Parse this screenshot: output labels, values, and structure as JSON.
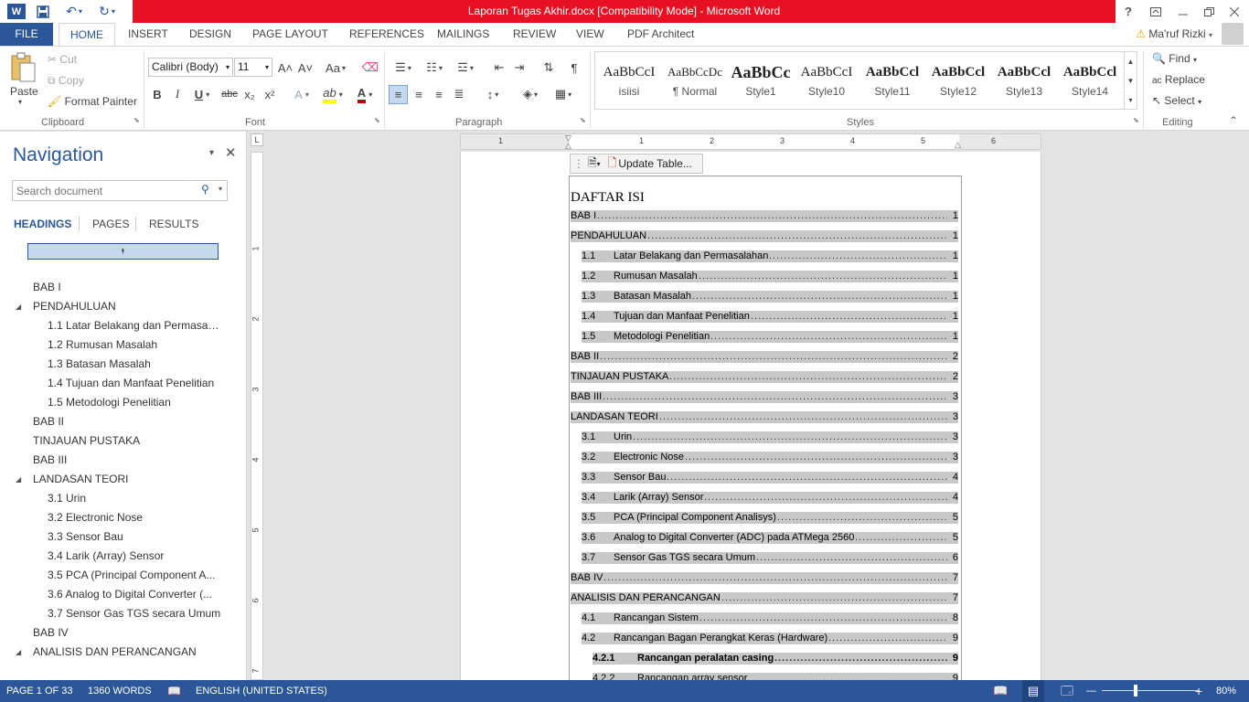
{
  "window": {
    "title": "Laporan Tugas Akhir.docx [Compatibility Mode] -  Microsoft Word",
    "help": "?",
    "buttons": {
      "restore_ribbon": "⬒",
      "minimize": "—",
      "maximize": "❐",
      "close": "✕"
    }
  },
  "quick_access": {
    "word_icon": "W",
    "save": "💾",
    "undo": "↶",
    "redo": "↻"
  },
  "ribbon_tabs": [
    "FILE",
    "HOME",
    "INSERT",
    "DESIGN",
    "PAGE LAYOUT",
    "REFERENCES",
    "MAILINGS",
    "REVIEW",
    "VIEW",
    "PDF Architect"
  ],
  "user": {
    "name": "Ma'ruf Rizki",
    "warning": "⚠"
  },
  "clipboard": {
    "paste": "Paste",
    "cut": "Cut",
    "copy": "Copy",
    "format_painter": "Format Painter",
    "label": "Clipboard"
  },
  "font": {
    "name": "Calibri (Body)",
    "size": "11",
    "grow": "A˄",
    "shrink": "A˅",
    "case": "Aa",
    "bold": "B",
    "italic": "I",
    "underline": "U",
    "strike": "abc",
    "subscript": "x₂",
    "superscript": "x²",
    "text_effects": "A",
    "highlight": "ab",
    "font_color": "A",
    "label": "Font"
  },
  "paragraph": {
    "label": "Paragraph",
    "pilcrow": "¶"
  },
  "styles": {
    "items": [
      {
        "preview": "AaBbCcI",
        "name": "isiisi"
      },
      {
        "preview": "AaBbCcDc",
        "name": "¶ Normal"
      },
      {
        "preview": "AaBbCс",
        "name": "Style1"
      },
      {
        "preview": "AaBbCcI",
        "name": "Style10"
      },
      {
        "preview": "AaBbCcl",
        "name": "Style11"
      },
      {
        "preview": "AaBbCcl",
        "name": "Style12"
      },
      {
        "preview": "AaBbCcl",
        "name": "Style13"
      },
      {
        "preview": "AaBbCcl",
        "name": "Style14"
      }
    ],
    "label": "Styles"
  },
  "editing": {
    "find": "Find",
    "replace": "Replace",
    "select": "Select",
    "label": "Editing"
  },
  "navigation": {
    "title": "Navigation",
    "search_placeholder": "Search document",
    "tabs": [
      "HEADINGS",
      "PAGES",
      "RESULTS"
    ],
    "items": [
      {
        "text": "BAB I",
        "level": 1,
        "expander": false
      },
      {
        "text": "PENDAHULUAN",
        "level": 1,
        "expander": true
      },
      {
        "text": "1.1 Latar Belakang dan Permasala...",
        "level": 2,
        "expander": false
      },
      {
        "text": "1.2 Rumusan Masalah",
        "level": 2,
        "expander": false
      },
      {
        "text": "1.3 Batasan Masalah",
        "level": 2,
        "expander": false
      },
      {
        "text": "1.4 Tujuan dan Manfaat Penelitian",
        "level": 2,
        "expander": false
      },
      {
        "text": "1.5  Metodologi Penelitian",
        "level": 2,
        "expander": false
      },
      {
        "text": "BAB II",
        "level": 1,
        "expander": false
      },
      {
        "text": "TINJAUAN PUSTAKA",
        "level": 1,
        "expander": false
      },
      {
        "text": "BAB III",
        "level": 1,
        "expander": false
      },
      {
        "text": "LANDASAN TEORI",
        "level": 1,
        "expander": true
      },
      {
        "text": "3.1 Urin",
        "level": 2,
        "expander": false
      },
      {
        "text": "3.2 Electronic Nose",
        "level": 2,
        "expander": false
      },
      {
        "text": "3.3 Sensor Bau",
        "level": 2,
        "expander": false
      },
      {
        "text": "3.4 Larik (Array) Sensor",
        "level": 2,
        "expander": false
      },
      {
        "text": "3.5 PCA (Principal Component A...",
        "level": 2,
        "expander": false
      },
      {
        "text": "3.6 Analog to Digital Converter (...",
        "level": 2,
        "expander": false
      },
      {
        "text": "3.7 Sensor Gas TGS secara Umum",
        "level": 2,
        "expander": false
      },
      {
        "text": "BAB IV",
        "level": 1,
        "expander": false
      },
      {
        "text": "ANALISIS DAN PERANCANGAN",
        "level": 1,
        "expander": true
      }
    ]
  },
  "ruler": {
    "h_numbers": [
      "1",
      "1",
      "2",
      "3",
      "4",
      "5",
      "6"
    ],
    "v_numbers": [
      "1",
      "2",
      "3",
      "4",
      "5",
      "6",
      "7"
    ],
    "corner": "L"
  },
  "document": {
    "toc_toolbar": {
      "update_label": "Update Table..."
    },
    "toc_heading": "DAFTAR ISI",
    "toc_entries": [
      {
        "num": "",
        "text": "BAB I",
        "page": "1",
        "indent": 0
      },
      {
        "num": "",
        "text": "PENDAHULUAN",
        "page": "1",
        "indent": 0
      },
      {
        "num": "1.1",
        "text": "Latar Belakang dan Permasalahan",
        "page": "1",
        "indent": 1
      },
      {
        "num": "1.2",
        "text": "Rumusan Masalah",
        "page": "1",
        "indent": 1
      },
      {
        "num": "1.3",
        "text": "Batasan Masalah",
        "page": "1",
        "indent": 1
      },
      {
        "num": "1.4",
        "text": "Tujuan dan Manfaat Penelitian",
        "page": "1",
        "indent": 1
      },
      {
        "num": "1.5",
        "text": "Metodologi Penelitian",
        "page": "1",
        "indent": 1
      },
      {
        "num": "",
        "text": "BAB II",
        "page": "2",
        "indent": 0
      },
      {
        "num": "",
        "text": "TINJAUAN PUSTAKA",
        "page": "2",
        "indent": 0
      },
      {
        "num": "",
        "text": "BAB III",
        "page": "3",
        "indent": 0
      },
      {
        "num": "",
        "text": "LANDASAN TEORI",
        "page": "3",
        "indent": 0
      },
      {
        "num": "3.1",
        "text": "Urin",
        "page": "3",
        "indent": 1
      },
      {
        "num": "3.2",
        "text": "Electronic Nose",
        "page": "3",
        "indent": 1
      },
      {
        "num": "3.3",
        "text": "Sensor Bau",
        "page": "4",
        "indent": 1
      },
      {
        "num": "3.4",
        "text": "Larik (Array) Sensor",
        "page": "4",
        "indent": 1
      },
      {
        "num": "3.5",
        "text": "PCA (Principal Component Analisys)",
        "page": "5",
        "indent": 1
      },
      {
        "num": "3.6",
        "text": "Analog to Digital Converter (ADC) pada ATMega 2560",
        "page": "5",
        "indent": 1
      },
      {
        "num": "3.7",
        "text": "Sensor Gas TGS secara Umum",
        "page": "6",
        "indent": 1
      },
      {
        "num": "",
        "text": "BAB IV",
        "page": "7",
        "indent": 0
      },
      {
        "num": "",
        "text": "ANALISIS DAN PERANCANGAN",
        "page": "7",
        "indent": 0
      },
      {
        "num": "4.1",
        "text": "Rancangan Sistem",
        "page": "8",
        "indent": 1
      },
      {
        "num": "4.2",
        "text": "Rancangan Bagan Perangkat Keras (Hardware)",
        "page": "9",
        "indent": 1
      },
      {
        "num": "4.2.1",
        "text": "Rancangan peralatan casing",
        "page": "9",
        "indent": 2,
        "bold": true
      },
      {
        "num": "4.2.2",
        "text": "Rancangan array sensor",
        "page": "9",
        "indent": 2
      }
    ]
  },
  "status": {
    "page": "PAGE 1 OF 33",
    "words": "1360 WORDS",
    "language": "ENGLISH (UNITED STATES)",
    "zoom": "80%",
    "zoom_minus": "—",
    "zoom_plus": "+"
  },
  "colors": {
    "accent": "#2b579a",
    "titlebar_red": "#e81123",
    "toc_shading": "#c8c8c8"
  }
}
